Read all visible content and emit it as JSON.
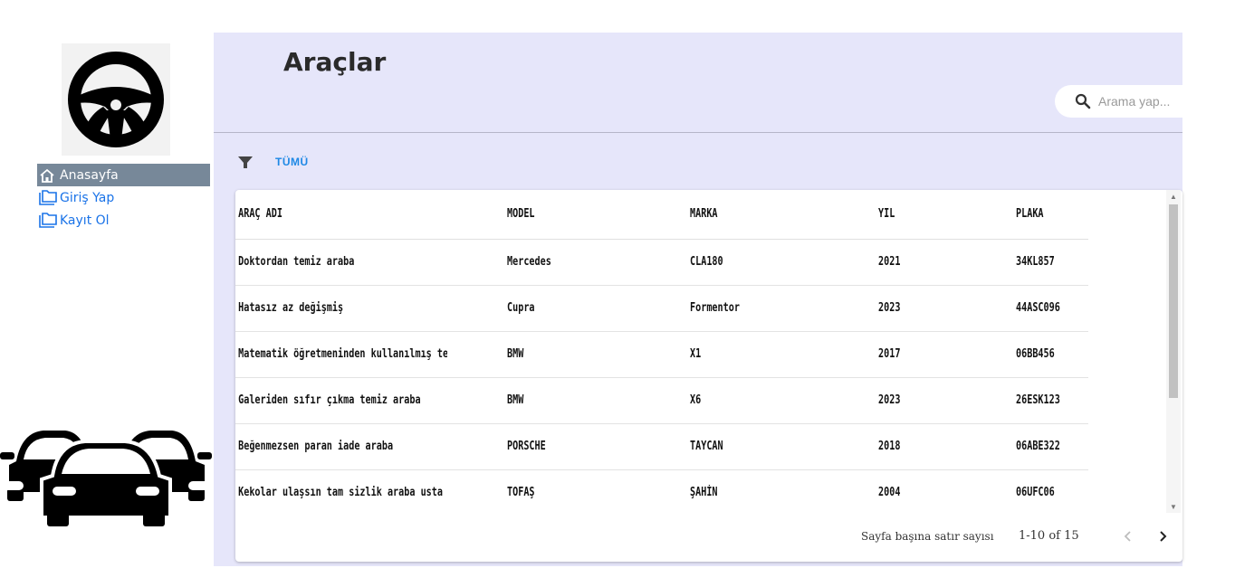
{
  "sidebar": {
    "items": [
      {
        "label": "Anasayfa",
        "icon": "home-icon",
        "active": true
      },
      {
        "label": "Giriş Yap",
        "icon": "folder-icon",
        "active": false
      },
      {
        "label": "Kayıt Ol",
        "icon": "folder-icon",
        "active": false
      }
    ],
    "logo_icon": "steering-wheel-icon",
    "illustration_icon": "cars-icon"
  },
  "header": {
    "title": "Araçlar",
    "search": {
      "placeholder": "Arama yap...",
      "value": "",
      "icon": "search-icon"
    }
  },
  "filter": {
    "icon": "filter-icon",
    "label": "TÜMÜ"
  },
  "table": {
    "columns": [
      "ARAÇ ADI",
      "MODEL",
      "MARKA",
      "YIL",
      "PLAKA"
    ],
    "rows": [
      [
        "Doktordan temiz araba",
        "Mercedes",
        "CLA180",
        "2021",
        "34KL857"
      ],
      [
        "Hatasız az değişmiş",
        "Cupra",
        "Formentor",
        "2023",
        "44ASC096"
      ],
      [
        "Matematik öğretmeninden kullanılmış temiz araba",
        "BMW",
        "X1",
        "2017",
        "06BB456"
      ],
      [
        "Galeriden sıfır çıkma temiz araba",
        "BMW",
        "X6",
        "2023",
        "26ESK123"
      ],
      [
        "Beğenmezsen paran iade araba",
        "PORSCHE",
        "TAYCAN",
        "2018",
        "06ABE322"
      ],
      [
        "Kekolar ulaşsın tam sizlik araba usta",
        "TOFAŞ",
        "ŞAHİN",
        "2004",
        "06UFC06"
      ]
    ]
  },
  "pagination": {
    "rows_per_page_label": "Sayfa başına satır sayısı",
    "range": "1-10 of 15",
    "prev_icon": "chevron-left-icon",
    "next_icon": "chevron-right-icon"
  },
  "colors": {
    "main_bg": "#e6e6fa",
    "active_nav_bg": "#778899",
    "link_blue": "#1a73e8",
    "filter_blue": "#1e88e5"
  }
}
